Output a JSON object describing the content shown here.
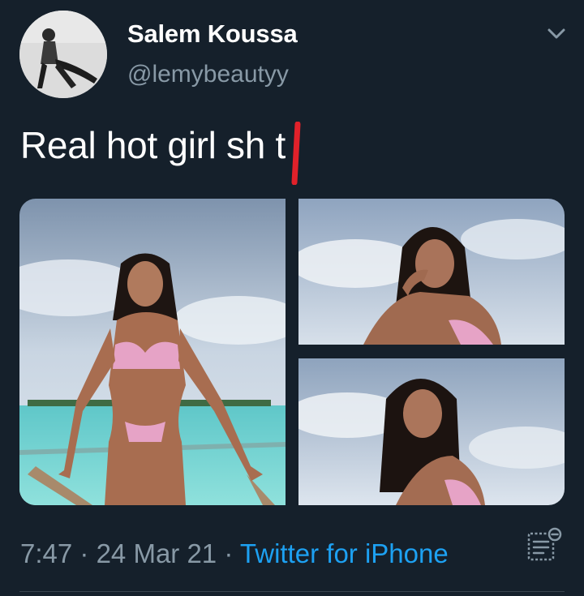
{
  "author": {
    "name": "Salem Koussa",
    "handle": "@lemybeautyy"
  },
  "tweet": {
    "text": "Real hot girl sh t"
  },
  "media": {
    "count": 3
  },
  "meta": {
    "time": "7:47",
    "separator": "·",
    "date": "24 Mar 21",
    "source": "Twitter for iPhone"
  },
  "colors": {
    "background": "#15202b",
    "text_primary": "#ffffff",
    "text_secondary": "#8899a6",
    "link": "#1da1f2",
    "censor_mark": "#e0212a"
  },
  "icons": {
    "menu": "chevron-down-icon",
    "analytics": "tweet-analytics-icon"
  }
}
